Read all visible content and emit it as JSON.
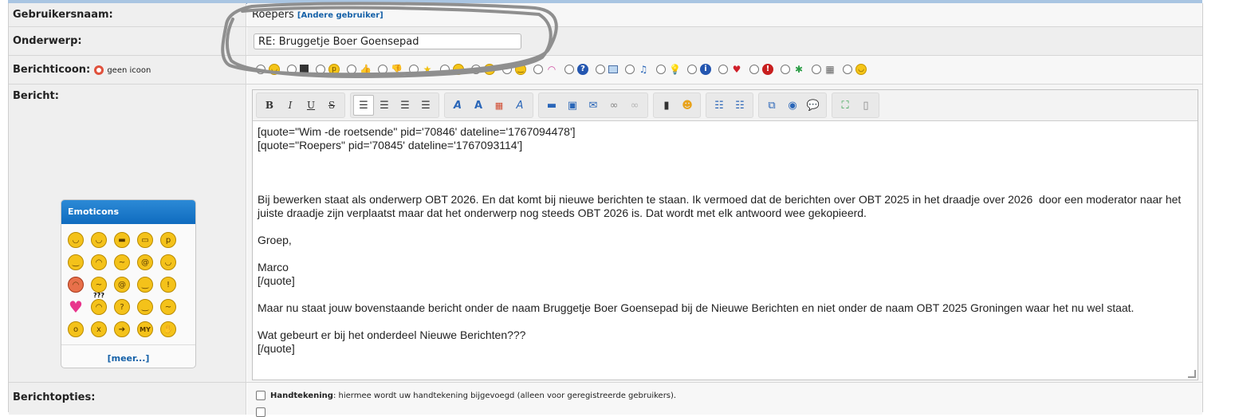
{
  "fields": {
    "username_label": "Gebruikersnaam:",
    "username_value": "Roepers",
    "other_user_link": "Andere gebruiker",
    "subject_label": "Onderwerp:",
    "subject_value": "RE: Bruggetje Boer Goensepad",
    "icon_label": "Berichticoon:",
    "no_icon_label": "geen icoon",
    "message_label": "Bericht:",
    "options_label": "Berichtopties:"
  },
  "message_icons": [
    "smile-icon",
    "film-icon",
    "tongue-icon",
    "thumbs-up-icon",
    "thumbs-down-icon",
    "star-icon",
    "grin-icon",
    "surprised-icon",
    "neutral-icon",
    "rainbow-icon",
    "question-icon",
    "picture-icon",
    "music-icon",
    "lightbulb-icon",
    "info-icon",
    "heart-icon",
    "exclamation-icon",
    "bug-icon",
    "castle-icon",
    "laugh-icon"
  ],
  "emoticons": {
    "title": "Emoticons",
    "more_link": "[meer...]",
    "items": [
      "smile",
      "happy",
      "cool",
      "grin",
      "tongue",
      "wink",
      "sad",
      "confused",
      "at",
      "angel",
      "angry",
      "worried",
      "dizzy",
      "sleepy",
      "exclamation",
      "heart",
      "huh",
      "idea",
      "smirk",
      "shy",
      "crying",
      "sick",
      "arrow",
      "my",
      "clap"
    ],
    "huh_text": "???",
    "at_text": "@",
    "my_text": "MY",
    "idea_text": "!"
  },
  "toolbar": {
    "bold": "B",
    "italic": "I",
    "underline": "U",
    "strike": "S"
  },
  "message": {
    "text": "[quote=\"Wim -de roetsende\" pid='70846' dateline='1767094478']\n[quote=\"Roepers\" pid='70845' dateline='1767093114']\n\n\n\nBij bewerken staat als onderwerp OBT 2026. En dat komt bij nieuwe berichten te staan. Ik vermoed dat de berichten over OBT 2025 in het draadje over 2026  door een moderator naar het\njuiste draadje zijn verplaatst maar dat het onderwerp nog steeds OBT 2026 is. Dat wordt met elk antwoord wee gekopieerd.\n\nGroep,\n\nMarco\n[/quote]\n\nMaar nu staat jouw bovenstaande bericht onder de naam Bruggetje Boer Goensepad bij de Nieuwe Berichten en niet onder de naam OBT 2025 Groningen waar het nu wel staat.\n\nWat gebeurt er bij het onderdeel Nieuwe Berichten???\n[/quote]"
  },
  "options": {
    "signature_label": "Handtekening",
    "signature_desc": ": hiermee wordt uw handtekening bijgevoegd (alleen voor geregistreerde gebruikers)."
  },
  "colors": {
    "link": "#1561a8",
    "header_blue": "#1a73c8"
  }
}
